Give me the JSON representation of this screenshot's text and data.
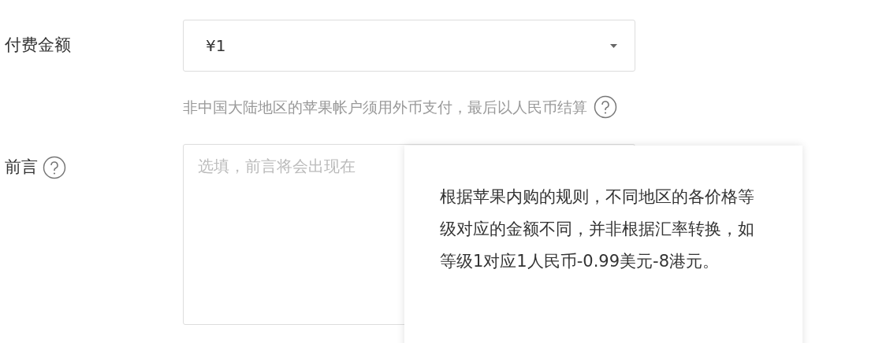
{
  "amount_row": {
    "label": "付费金额",
    "select_value": "¥1",
    "hint": "非中国大陆地区的苹果帐户须用外币支付，最后以人民币结算"
  },
  "preface_row": {
    "label": "前言",
    "placeholder": "选填，前言将会出现在"
  },
  "tooltip": {
    "text": "根据苹果内购的规则，不同地区的各价格等级对应的金额不同，并非根据汇率转换，如等级1对应1人民币-0.99美元-8港元。"
  }
}
